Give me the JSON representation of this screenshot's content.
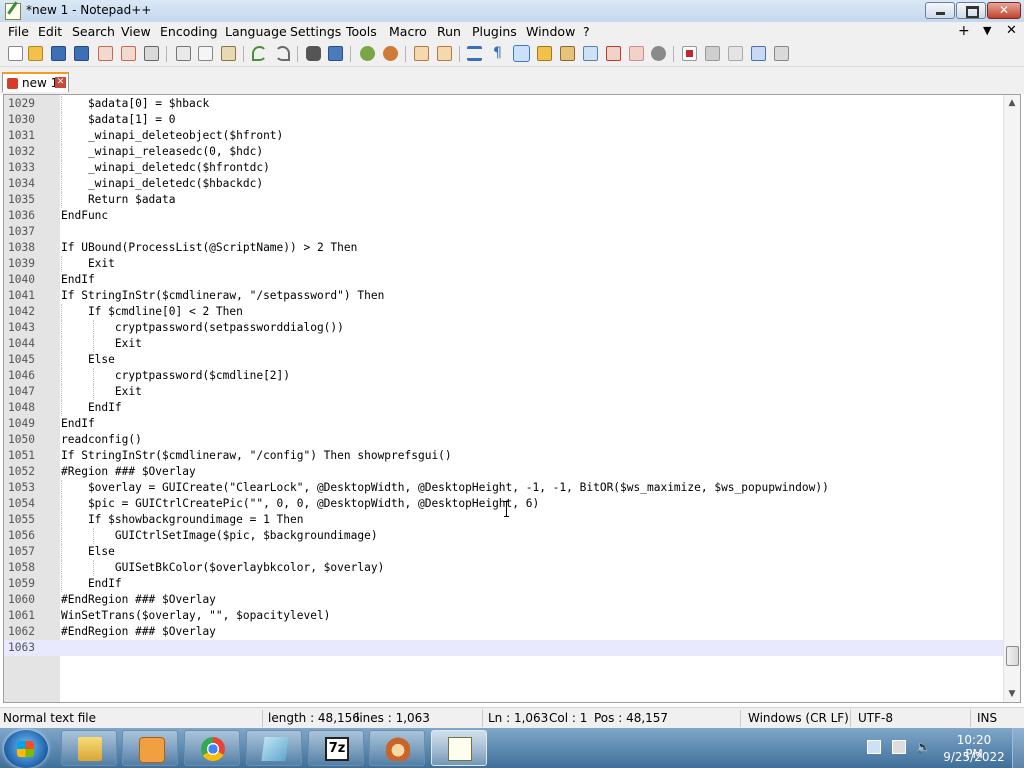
{
  "window": {
    "title": "*new 1 - Notepad++"
  },
  "menu": {
    "items": [
      {
        "label": "File",
        "key": "file"
      },
      {
        "label": "Edit",
        "key": "edit"
      },
      {
        "label": "Search",
        "key": "search"
      },
      {
        "label": "View",
        "key": "view"
      },
      {
        "label": "Encoding",
        "key": "encoding"
      },
      {
        "label": "Language",
        "key": "language"
      },
      {
        "label": "Settings",
        "key": "settings"
      },
      {
        "label": "Tools",
        "key": "tools"
      },
      {
        "label": "Macro",
        "key": "macro"
      },
      {
        "label": "Run",
        "key": "run"
      },
      {
        "label": "Plugins",
        "key": "plugins"
      },
      {
        "label": "Window",
        "key": "window"
      },
      {
        "label": "?",
        "key": "help"
      }
    ],
    "right_plus": "+",
    "right_down": "▼",
    "right_close": "✕"
  },
  "toolbar": {
    "icons": [
      "new-file-icon",
      "open-file-icon",
      "save-icon",
      "save-all-icon",
      "close-icon",
      "close-all-icon",
      "print-icon",
      "cut-icon",
      "copy-icon",
      "paste-icon",
      "undo-icon",
      "redo-icon",
      "find-icon",
      "replace-icon",
      "zoom-in-icon",
      "zoom-out-icon",
      "sync-vertical-icon",
      "sync-horizontal-icon",
      "word-wrap-icon",
      "show-all-chars-icon",
      "indent-guide-icon",
      "user-defined-language-icon",
      "doc-map-icon",
      "function-list-icon",
      "folder-workspace-icon",
      "monitoring-icon",
      "record-macro-icon",
      "stop-macro-icon",
      "play-macro-icon",
      "run-macro-multiple-icon",
      "save-macro-icon"
    ],
    "selected": "indent-guide-icon"
  },
  "tabs": [
    {
      "label": "new 1",
      "close": "✕"
    }
  ],
  "editor": {
    "current_line": 1063,
    "lines": [
      {
        "n": "1029",
        "text": "    $adata[0] = $hback",
        "indent": 1
      },
      {
        "n": "1030",
        "text": "    $adata[1] = 0",
        "indent": 1
      },
      {
        "n": "1031",
        "text": "    _winapi_deleteobject($hfront)",
        "indent": 1
      },
      {
        "n": "1032",
        "text": "    _winapi_releasedc(0, $hdc)",
        "indent": 1
      },
      {
        "n": "1033",
        "text": "    _winapi_deletedc($hfrontdc)",
        "indent": 1
      },
      {
        "n": "1034",
        "text": "    _winapi_deletedc($hbackdc)",
        "indent": 1
      },
      {
        "n": "1035",
        "text": "    Return $adata",
        "indent": 1
      },
      {
        "n": "1036",
        "text": "EndFunc",
        "indent": 0
      },
      {
        "n": "1037",
        "text": "",
        "indent": 0
      },
      {
        "n": "1038",
        "text": "If UBound(ProcessList(@ScriptName)) > 2 Then",
        "indent": 0
      },
      {
        "n": "1039",
        "text": "    Exit",
        "indent": 1
      },
      {
        "n": "1040",
        "text": "EndIf",
        "indent": 0
      },
      {
        "n": "1041",
        "text": "If StringInStr($cmdlineraw, \"/setpassword\") Then",
        "indent": 0
      },
      {
        "n": "1042",
        "text": "    If $cmdline[0] < 2 Then",
        "indent": 1
      },
      {
        "n": "1043",
        "text": "        cryptpassword(setpassworddialog())",
        "indent": 2
      },
      {
        "n": "1044",
        "text": "        Exit",
        "indent": 2
      },
      {
        "n": "1045",
        "text": "    Else",
        "indent": 1
      },
      {
        "n": "1046",
        "text": "        cryptpassword($cmdline[2])",
        "indent": 2
      },
      {
        "n": "1047",
        "text": "        Exit",
        "indent": 2
      },
      {
        "n": "1048",
        "text": "    EndIf",
        "indent": 1
      },
      {
        "n": "1049",
        "text": "EndIf",
        "indent": 0
      },
      {
        "n": "1050",
        "text": "readconfig()",
        "indent": 0
      },
      {
        "n": "1051",
        "text": "If StringInStr($cmdlineraw, \"/config\") Then showprefsgui()",
        "indent": 0
      },
      {
        "n": "1052",
        "text": "#Region ### $Overlay",
        "indent": 0
      },
      {
        "n": "1053",
        "text": "    $overlay = GUICreate(\"ClearLock\", @DesktopWidth, @DesktopHeight, -1, -1, BitOR($ws_maximize, $ws_popupwindow))",
        "indent": 1
      },
      {
        "n": "1054",
        "text": "    $pic = GUICtrlCreatePic(\"\", 0, 0, @DesktopWidth, @DesktopHeight, 6)",
        "indent": 1
      },
      {
        "n": "1055",
        "text": "    If $showbackgroundimage = 1 Then",
        "indent": 1
      },
      {
        "n": "1056",
        "text": "        GUICtrlSetImage($pic, $backgroundimage)",
        "indent": 2
      },
      {
        "n": "1057",
        "text": "    Else",
        "indent": 1
      },
      {
        "n": "1058",
        "text": "        GUISetBkColor($overlaybkcolor, $overlay)",
        "indent": 2
      },
      {
        "n": "1059",
        "text": "    EndIf",
        "indent": 1
      },
      {
        "n": "1060",
        "text": "#EndRegion ### $Overlay",
        "indent": 0
      },
      {
        "n": "1061",
        "text": "WinSetTrans($overlay, \"\", $opacitylevel)",
        "indent": 0
      },
      {
        "n": "1062",
        "text": "#EndRegion ### $Overlay",
        "indent": 0
      },
      {
        "n": "1063",
        "text": "",
        "indent": 0
      }
    ]
  },
  "status": {
    "file_type": "Normal text file",
    "length": "length : 48,156",
    "lines": "lines : 1,063",
    "ln": "Ln : 1,063",
    "col": "Col : 1",
    "pos": "Pos : 48,157",
    "eol": "Windows (CR LF)",
    "encoding": "UTF-8",
    "mode": "INS"
  },
  "taskbar": {
    "apps": [
      "file-explorer-icon",
      "media-player-icon",
      "chrome-icon",
      "notepad-blue-icon",
      "7zip-icon",
      "lion-app-icon",
      "notepadpp-icon"
    ],
    "active": "notepadpp-icon",
    "seven_zip_label": "7z",
    "clock_time": "10:20 PM",
    "clock_date": "9/25/2022"
  },
  "colors": {
    "tab_accent": "#f59a23",
    "current_line": "#e8e8ff",
    "gutter": "#e4e4e4"
  }
}
